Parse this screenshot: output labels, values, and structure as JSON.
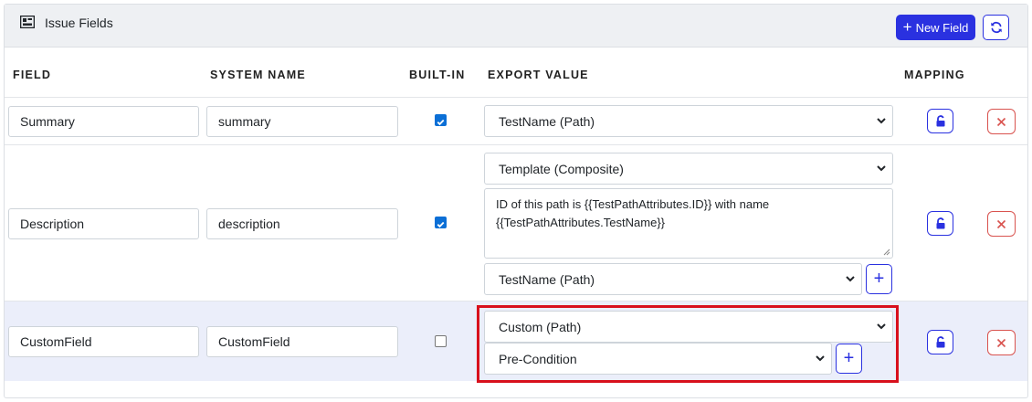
{
  "header": {
    "title": "Issue Fields",
    "new_field_label": "New Field",
    "icons": {
      "panel": "table-layout-icon",
      "new": "plus-icon",
      "refresh": "refresh-icon"
    }
  },
  "columns": {
    "field": "FIELD",
    "system_name": "SYSTEM NAME",
    "built_in": "BUILT-IN",
    "export_value": "EXPORT VALUE",
    "mapping": "MAPPING"
  },
  "rows": [
    {
      "field": "Summary",
      "system_name": "summary",
      "built_in": true,
      "export_type": "TestName (Path)"
    },
    {
      "field": "Description",
      "system_name": "description",
      "built_in": true,
      "export_type": "Template (Composite)",
      "template_text_line1": "ID of this path is {{TestPathAttributes.ID}} with name",
      "template_text_line2": "{{TestPathAttributes.TestName}}",
      "insert_attribute": "TestName (Path)"
    },
    {
      "field": "CustomField",
      "system_name": "CustomField",
      "built_in": false,
      "export_type": "Custom (Path)",
      "custom_attribute": "Pre-Condition"
    }
  ],
  "colors": {
    "primary": "#2a31e0",
    "danger": "#d9534f",
    "highlight_box": "#d8101c",
    "row_highlight": "#ebeefa",
    "checkbox": "#0b6fd6"
  }
}
